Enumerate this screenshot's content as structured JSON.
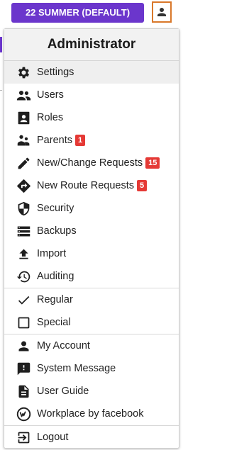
{
  "topbar": {
    "term_label": "22 SUMMER (DEFAULT)",
    "user_icon": "person-icon"
  },
  "menu": {
    "title": "Administrator",
    "sections": [
      [
        {
          "label": "Settings",
          "icon": "gear-icon",
          "active": true
        },
        {
          "label": "Users",
          "icon": "users-icon"
        },
        {
          "label": "Roles",
          "icon": "contact-badge-icon"
        },
        {
          "label": "Parents",
          "icon": "parents-icon",
          "badge": "1"
        },
        {
          "label": "New/Change Requests",
          "icon": "pencil-icon",
          "badge": "15"
        },
        {
          "label": "New Route Requests",
          "icon": "route-arrow-icon",
          "badge": "5"
        },
        {
          "label": "Security",
          "icon": "shield-icon"
        },
        {
          "label": "Backups",
          "icon": "backup-list-icon"
        },
        {
          "label": "Import",
          "icon": "upload-icon"
        },
        {
          "label": "Auditing",
          "icon": "history-icon"
        }
      ],
      [
        {
          "label": "Regular",
          "icon": "checkmark-icon"
        },
        {
          "label": "Special",
          "icon": "empty-checkbox-icon"
        }
      ],
      [
        {
          "label": "My Account",
          "icon": "person-icon"
        },
        {
          "label": "System Message",
          "icon": "message-alert-icon"
        },
        {
          "label": "User Guide",
          "icon": "document-icon"
        },
        {
          "label": "Workplace by facebook",
          "icon": "workplace-logo-icon"
        }
      ],
      [
        {
          "label": "Logout",
          "icon": "logout-icon"
        }
      ]
    ]
  },
  "colors": {
    "accent": "#6b36cc",
    "user_button_border": "#d9782a",
    "badge": "#e53935"
  }
}
